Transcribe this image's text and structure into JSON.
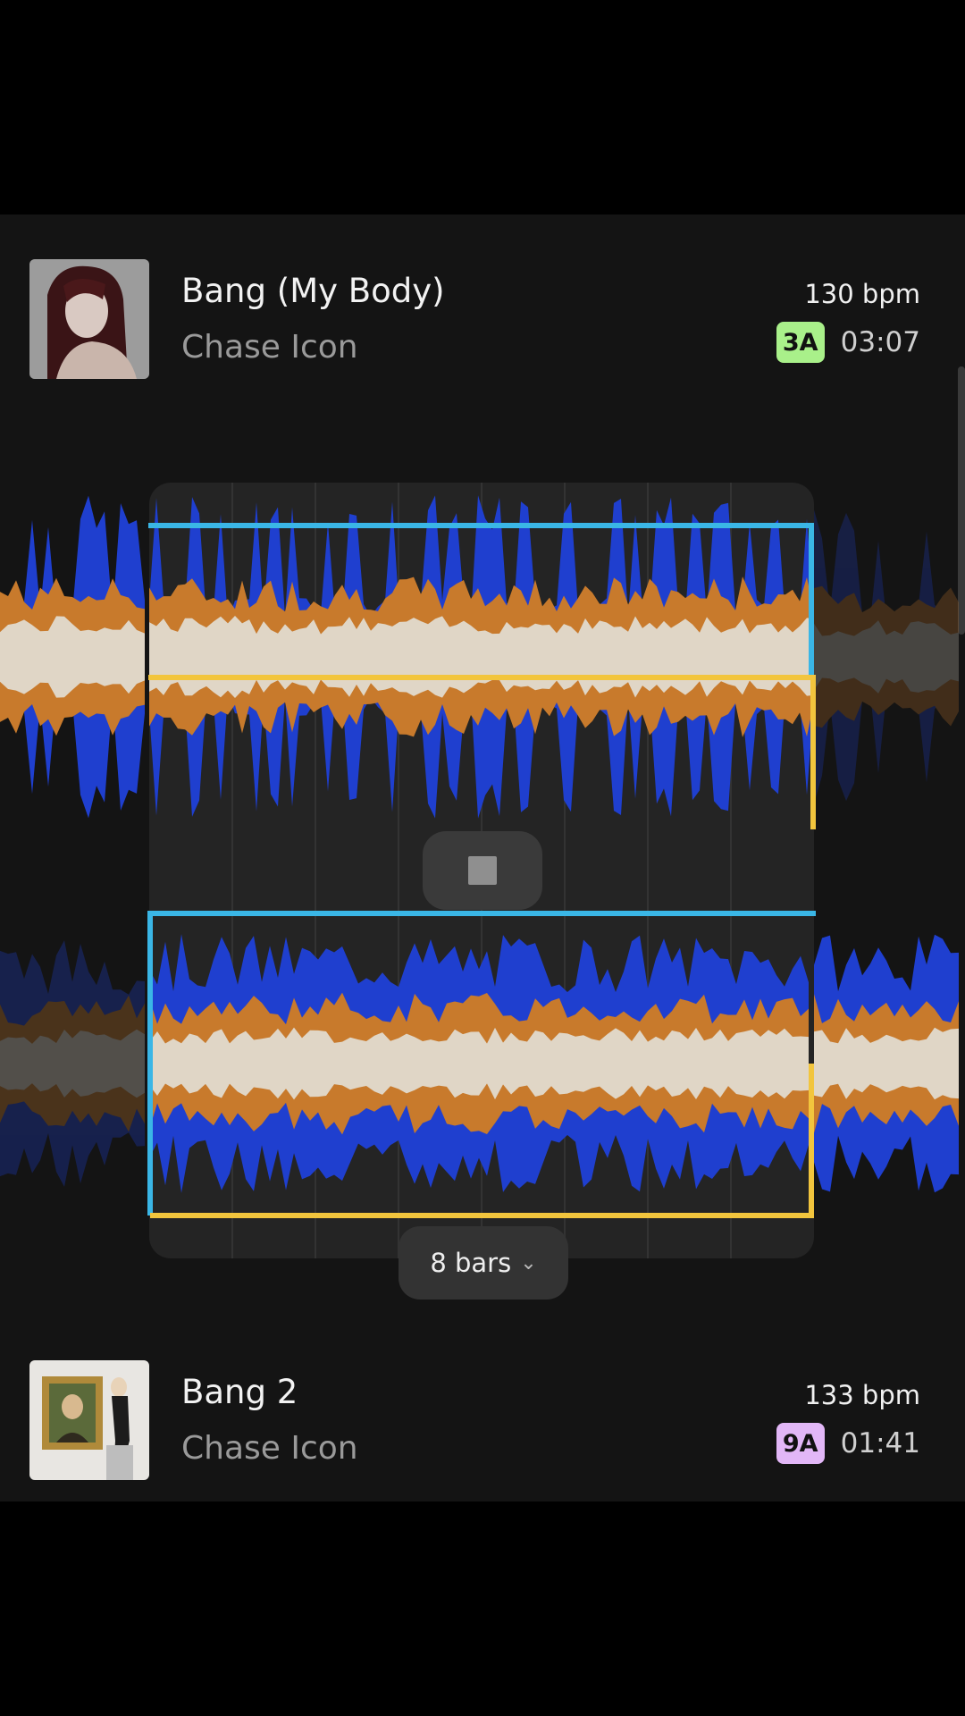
{
  "tracks": [
    {
      "title": "Bang (My Body)",
      "artist": "Chase Icon",
      "bpm": "130 bpm",
      "key": "3A",
      "key_color": "#a9f08a",
      "duration": "03:07"
    },
    {
      "title": "Bang 2",
      "artist": "Chase Icon",
      "bpm": "133 bpm",
      "key": "9A",
      "key_color": "#e2b7f7",
      "duration": "01:41"
    }
  ],
  "loop": {
    "length_label": "8 bars"
  },
  "colors": {
    "low_band": "#1f3fcf",
    "mid_band": "#c87a2c",
    "high_band": "#e0d6c6",
    "loop_top": "#3ab6e6",
    "loop_bottom": "#f2c53d"
  },
  "icons": {
    "stop": "stop-icon",
    "chevron": "chevron-down-icon"
  }
}
